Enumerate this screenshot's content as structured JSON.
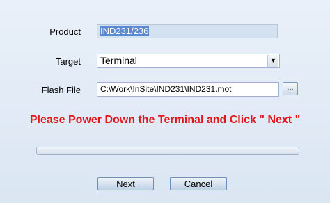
{
  "form": {
    "product_label": "Product",
    "product_value": "IND231/236",
    "target_label": "Target",
    "target_value": "Terminal",
    "flash_label": "Flash File",
    "flash_value": "C:\\Work\\InSite\\IND231\\IND231.mot",
    "browse_label": "..."
  },
  "warning": "Please Power Down the Terminal and Click \" Next \"",
  "progress": {
    "fraction": 0
  },
  "buttons": {
    "next": "Next",
    "cancel": "Cancel"
  },
  "colors": {
    "warning": "#e3161a",
    "background": "#dde8f5",
    "selection": "#5a8bd1"
  },
  "icons": {
    "dropdown": "chevron-down-icon"
  }
}
